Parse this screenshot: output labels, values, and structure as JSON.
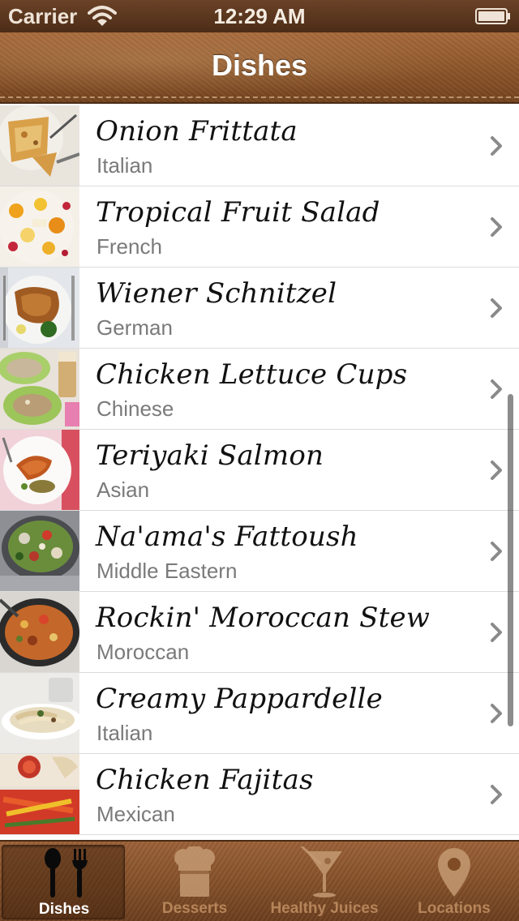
{
  "status_bar": {
    "carrier": "Carrier",
    "time": "12:29 AM"
  },
  "nav": {
    "title": "Dishes"
  },
  "dishes": [
    {
      "name": "Onion Frittata",
      "cuisine": "Italian"
    },
    {
      "name": "Tropical Fruit Salad",
      "cuisine": "French"
    },
    {
      "name": "Wiener Schnitzel",
      "cuisine": "German"
    },
    {
      "name": "Chicken Lettuce Cups",
      "cuisine": "Chinese"
    },
    {
      "name": "Teriyaki Salmon",
      "cuisine": "Asian"
    },
    {
      "name": "Na'ama's Fattoush",
      "cuisine": "Middle Eastern"
    },
    {
      "name": "Rockin' Moroccan Stew",
      "cuisine": "Moroccan"
    },
    {
      "name": "Creamy Pappardelle",
      "cuisine": "Italian"
    },
    {
      "name": "Chicken Fajitas",
      "cuisine": "Mexican"
    }
  ],
  "tabs": [
    {
      "label": "Dishes",
      "icon": "fork-spoon-icon",
      "selected": true
    },
    {
      "label": "Desserts",
      "icon": "chef-hat-icon",
      "selected": false
    },
    {
      "label": "Healthy Juices",
      "icon": "cocktail-glass-icon",
      "selected": false
    },
    {
      "label": "Locations",
      "icon": "map-pin-icon",
      "selected": false
    }
  ],
  "colors": {
    "leather_light": "#a6683a",
    "leather_dark": "#6a3d1d",
    "cuisine_text": "#7a7a7a",
    "chevron": "#8a8a8a"
  }
}
